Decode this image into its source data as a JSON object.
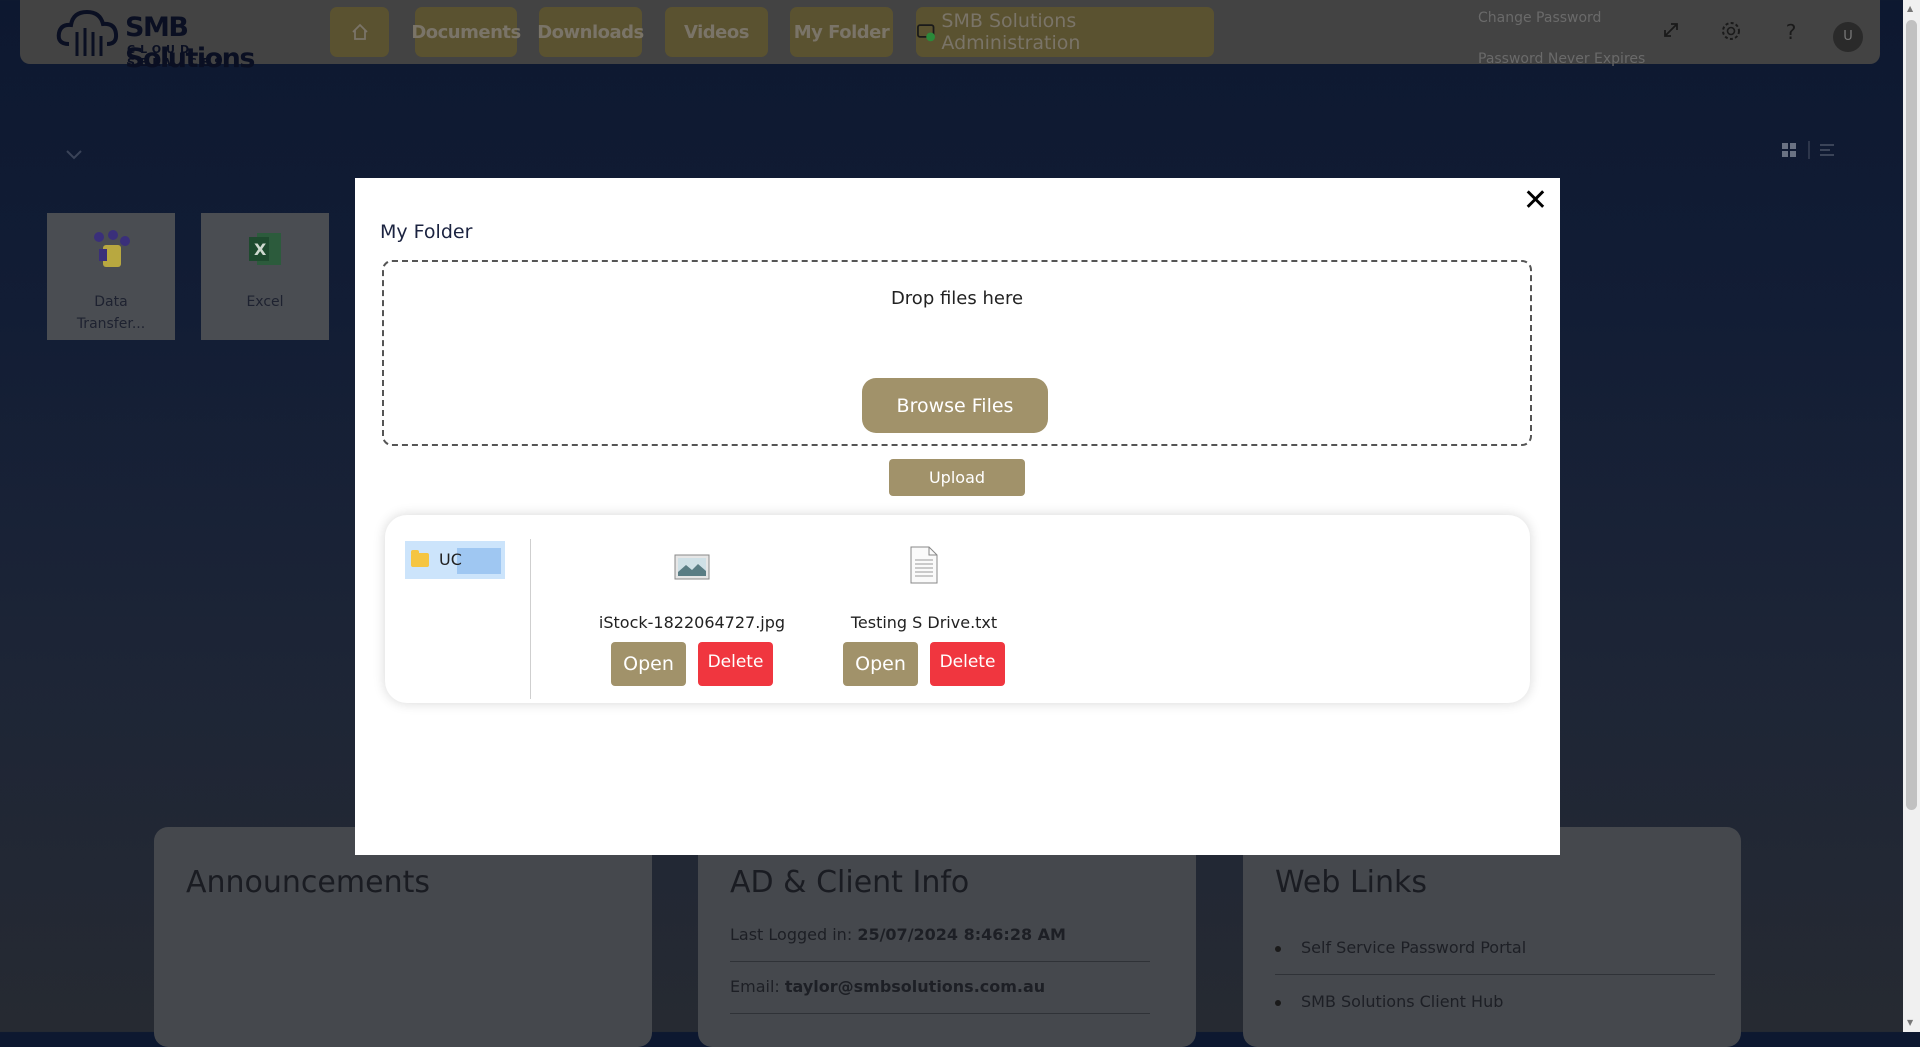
{
  "brand": {
    "name": "SMB Solutions",
    "tagline": "CLOUD SERVICES"
  },
  "nav": {
    "home_icon": "home-icon",
    "items": [
      "Documents",
      "Downloads",
      "Videos",
      "My Folder"
    ],
    "admin_label": "SMB Solutions Administration"
  },
  "account": {
    "change_password": "Change Password",
    "password_status": "Password Never Expires",
    "avatar_initial": "U"
  },
  "background": {
    "apps": [
      {
        "label": "Data Transfer..."
      },
      {
        "label": "Excel"
      }
    ],
    "panels": {
      "announcements": {
        "title": "Announcements"
      },
      "ad_info": {
        "title": "AD & Client Info",
        "last_logged_label": "Last Logged in:",
        "last_logged_value": "25/07/2024 8:46:28 AM",
        "email_label": "Email:",
        "email_value": "taylor@smbsolutions.com.au"
      },
      "web_links": {
        "title": "Web Links",
        "links": [
          "Self Service Password Portal",
          "SMB Solutions Client Hub"
        ]
      }
    }
  },
  "modal": {
    "title": "My Folder",
    "drop_text": "Drop files here",
    "browse_label": "Browse Files",
    "upload_label": "Upload",
    "folder": {
      "name": "UC"
    },
    "files": [
      {
        "name": "iStock-1822064727.jpg",
        "icon": "image-file-icon",
        "open_label": "Open",
        "delete_label": "Delete"
      },
      {
        "name": "Testing S Drive.txt",
        "icon": "text-file-icon",
        "open_label": "Open",
        "delete_label": "Delete"
      }
    ]
  }
}
